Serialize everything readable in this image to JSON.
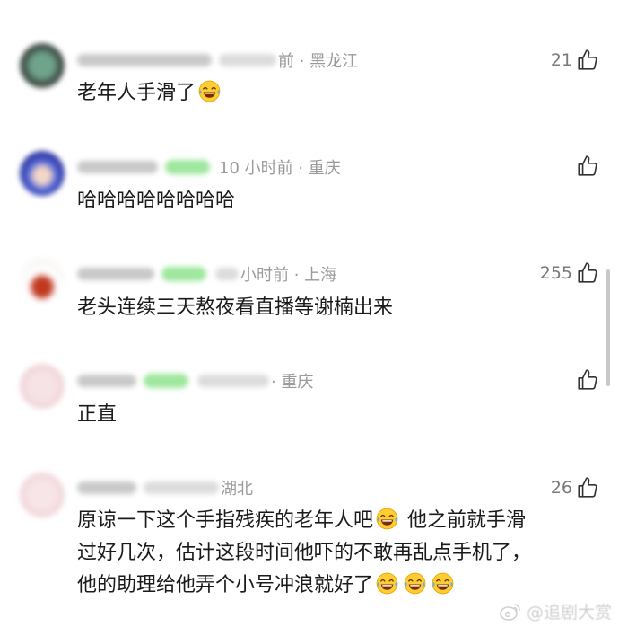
{
  "comments": [
    {
      "location_meta": "前 · 黑龙江",
      "likes": "21",
      "text": "老年人手滑了",
      "emojis": 1
    },
    {
      "location_meta": "10 小时前 · 重庆",
      "likes": "",
      "text": "哈哈哈哈哈哈哈哈"
    },
    {
      "location_meta": "小时前 · 上海",
      "likes": "255",
      "text": "老头连续三天熬夜看直播等谢楠出来"
    },
    {
      "location_meta": "· 重庆",
      "likes": "",
      "text": "正直"
    },
    {
      "location_meta": "湖北",
      "likes": "26",
      "line1": "原谅一下这个手指残疾的老年人吧",
      "line1b": " 他之前就手滑",
      "line2": "过好几次，估计这段时间他吓的不敢再乱点手机了，",
      "line3": "他的助理给他弄个小号冲浪就好了"
    }
  ],
  "watermark": {
    "text": "@追剧大赏"
  },
  "colors": {
    "meta": "#9a9a9a",
    "text": "#1a1a1a",
    "badge": "#9fe79f",
    "emoji": "#ffcc33"
  },
  "icons": {
    "like": "thumbs-up-outline-icon",
    "emoji": "tears-of-joy-emoji",
    "watermark": "weibo-logo-icon"
  }
}
